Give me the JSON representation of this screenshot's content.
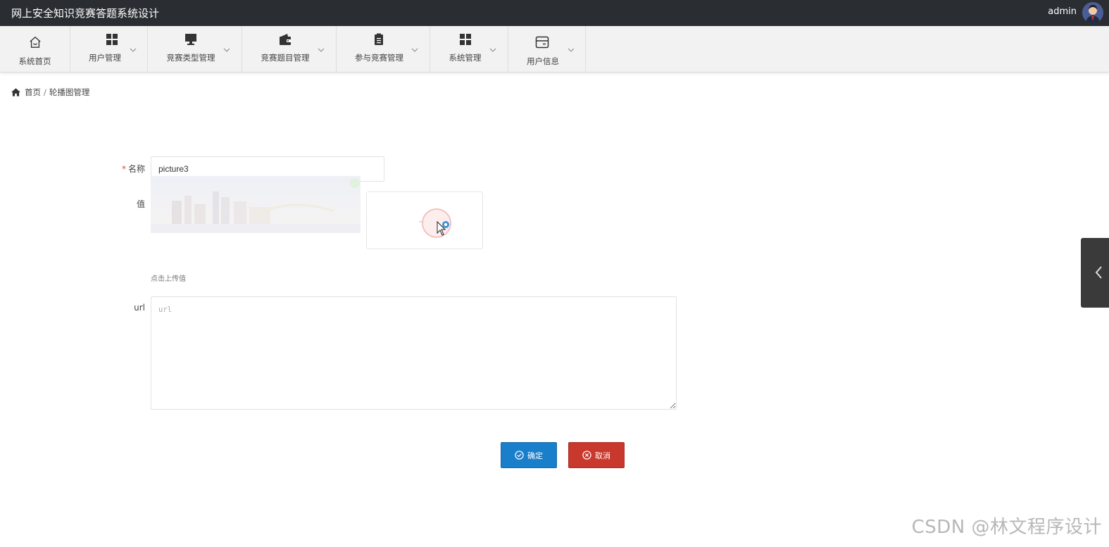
{
  "header": {
    "title": "网上安全知识竞赛答题系统设计",
    "user": "admin"
  },
  "nav": [
    {
      "label": "系统首页",
      "icon": "home-icon",
      "has_dropdown": false
    },
    {
      "label": "用户管理",
      "icon": "grid-icon",
      "has_dropdown": true
    },
    {
      "label": "竞赛类型管理",
      "icon": "monitor-icon",
      "has_dropdown": true
    },
    {
      "label": "竞赛题目管理",
      "icon": "wallet-icon",
      "has_dropdown": true
    },
    {
      "label": "参与竞赛管理",
      "icon": "clipboard-icon",
      "has_dropdown": true
    },
    {
      "label": "系统管理",
      "icon": "grid-icon",
      "has_dropdown": true
    },
    {
      "label": "用户信息",
      "icon": "card-icon",
      "has_dropdown": true
    }
  ],
  "breadcrumb": {
    "home": "首页",
    "separator": "/",
    "current": "轮播图管理"
  },
  "form": {
    "name_label": "名称",
    "name_required_mark": "*",
    "name_value": "picture3",
    "value_label": "值",
    "upload_tip": "点击上传值",
    "url_label": "url",
    "url_placeholder": "url",
    "url_value": ""
  },
  "buttons": {
    "ok": "确定",
    "cancel": "取消"
  },
  "watermark": "CSDN @林文程序设计",
  "colors": {
    "topbar": "#2a2e33",
    "primary": "#1a7fcb",
    "danger": "#c9382d",
    "required": "#e74c3c"
  }
}
